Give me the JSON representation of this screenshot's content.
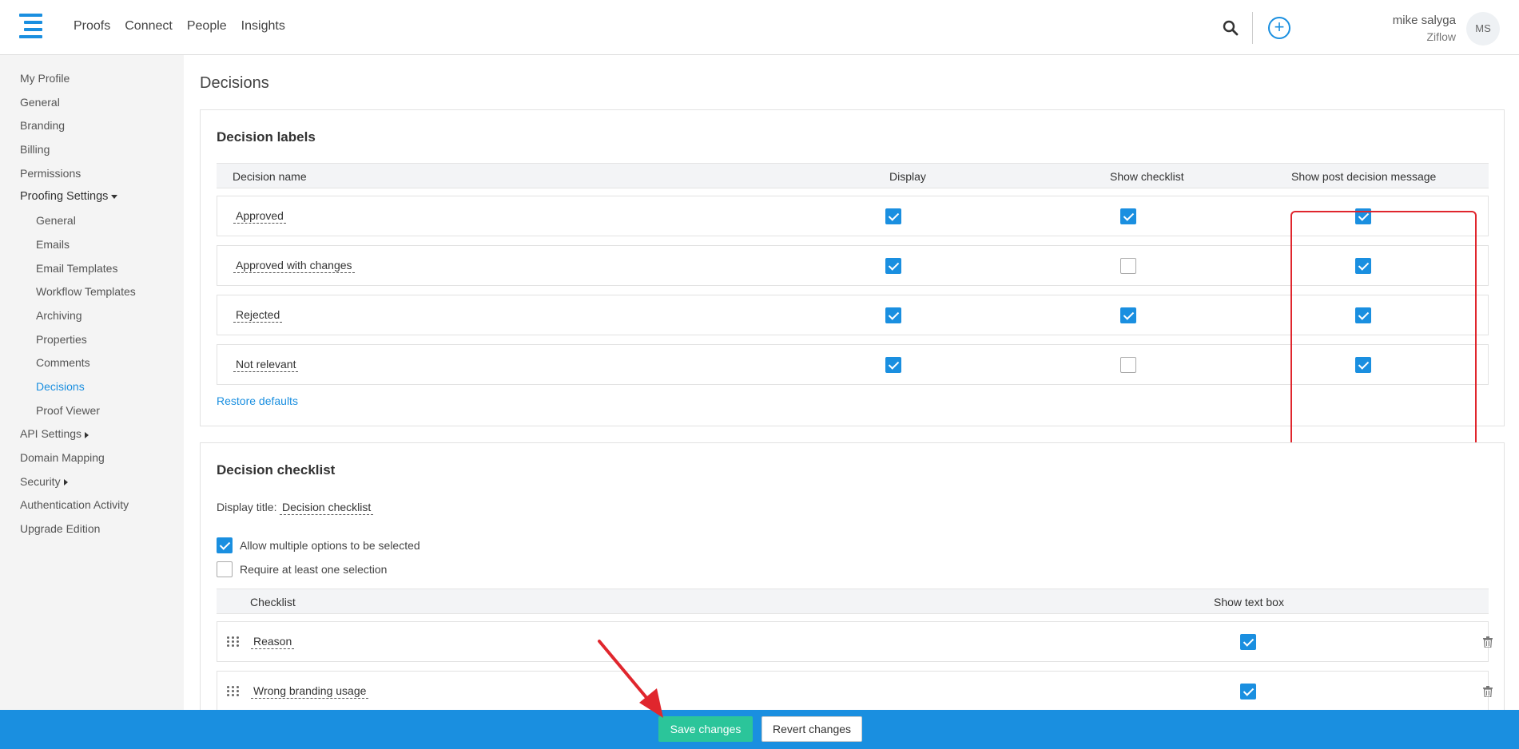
{
  "header": {
    "nav": [
      "Proofs",
      "Connect",
      "People",
      "Insights"
    ],
    "user_name": "mike salyga",
    "user_org": "Ziflow",
    "avatar_initials": "MS",
    "add_symbol": "+"
  },
  "sidebar": {
    "items": [
      {
        "label": "My Profile"
      },
      {
        "label": "General"
      },
      {
        "label": "Branding"
      },
      {
        "label": "Billing"
      },
      {
        "label": "Permissions"
      },
      {
        "label": "Proofing Settings"
      },
      {
        "label": "General"
      },
      {
        "label": "Emails"
      },
      {
        "label": "Email Templates"
      },
      {
        "label": "Workflow Templates"
      },
      {
        "label": "Archiving"
      },
      {
        "label": "Properties"
      },
      {
        "label": "Comments"
      },
      {
        "label": "Decisions"
      },
      {
        "label": "Proof Viewer"
      },
      {
        "label": "API Settings"
      },
      {
        "label": "Domain Mapping"
      },
      {
        "label": "Security"
      },
      {
        "label": "Authentication Activity"
      },
      {
        "label": "Upgrade Edition"
      }
    ]
  },
  "main": {
    "page_title": "Decisions",
    "decision_labels": {
      "title": "Decision labels",
      "columns": [
        "Decision name",
        "Display",
        "Show checklist",
        "Show post decision message"
      ],
      "rows": [
        {
          "name": "Approved",
          "display": true,
          "show_checklist": true,
          "show_post_message": true
        },
        {
          "name": "Approved with changes",
          "display": true,
          "show_checklist": false,
          "show_post_message": true
        },
        {
          "name": "Rejected",
          "display": true,
          "show_checklist": true,
          "show_post_message": true
        },
        {
          "name": "Not relevant",
          "display": true,
          "show_checklist": false,
          "show_post_message": true
        }
      ],
      "restore_defaults": "Restore defaults"
    },
    "decision_checklist": {
      "title": "Decision checklist",
      "display_title_label": "Display title:",
      "display_title_value": "Decision checklist",
      "options": [
        {
          "label": "Allow multiple options to be selected",
          "checked": true
        },
        {
          "label": "Require at least one selection",
          "checked": false
        }
      ],
      "columns": [
        "Checklist",
        "Show text box"
      ],
      "rows": [
        {
          "name": "Reason",
          "show_text_box": true
        },
        {
          "name": "Wrong branding usage",
          "show_text_box": true
        }
      ]
    }
  },
  "footer": {
    "save_label": "Save changes",
    "revert_label": "Revert changes"
  },
  "colors": {
    "accent": "#1a8fe0",
    "save_button": "#2bc59a",
    "highlight": "#e0262d"
  }
}
